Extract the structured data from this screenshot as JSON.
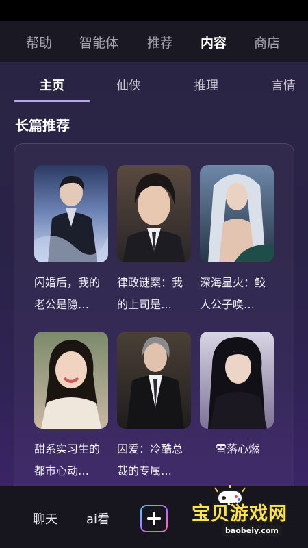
{
  "top_nav": {
    "items": [
      {
        "label": "帮助",
        "active": false
      },
      {
        "label": "智能体",
        "active": false
      },
      {
        "label": "推荐",
        "active": false
      },
      {
        "label": "内容",
        "active": true
      },
      {
        "label": "商店",
        "active": false
      }
    ]
  },
  "sub_tabs": {
    "items": [
      {
        "label": "主页",
        "active": true
      },
      {
        "label": "仙侠",
        "active": false
      },
      {
        "label": "推理",
        "active": false
      },
      {
        "label": "言情",
        "active": false
      }
    ]
  },
  "section": {
    "title": "长篇推荐"
  },
  "books": [
    {
      "title": "闪婚后，我的老公是隐…"
    },
    {
      "title": "律政谜案：我的上司是…"
    },
    {
      "title": "深海星火：鲛人公子唤…"
    },
    {
      "title": "甜系实习生的都市心动…"
    },
    {
      "title": "囚爱：冷酷总裁的专属…"
    },
    {
      "title": "雪落心燃"
    }
  ],
  "bottom_nav": {
    "chat_label": "聊天",
    "ai_label": "ai看",
    "create_icon": "plus-icon"
  },
  "watermark": {
    "text": "宝贝游戏网",
    "url": "baobeiy.com"
  },
  "colors": {
    "accent": "#b9a7ea",
    "background": "#2a2348",
    "nav_bg": "#1a1822"
  }
}
